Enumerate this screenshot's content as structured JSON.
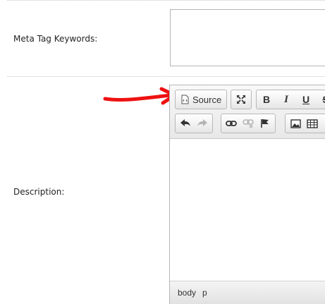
{
  "form": {
    "keywords": {
      "label": "Meta Tag Keywords:",
      "value": ""
    },
    "description": {
      "label": "Description:"
    }
  },
  "editor": {
    "toolbar": {
      "source_label": "Source",
      "bold_label": "B",
      "italic_label": "I",
      "underline_label": "U",
      "strike_label": "S"
    },
    "status_path": [
      "body",
      "p"
    ]
  },
  "colors": {
    "annotation_arrow": "#ee1111",
    "toolbar_bg": "#f2f2f2"
  }
}
